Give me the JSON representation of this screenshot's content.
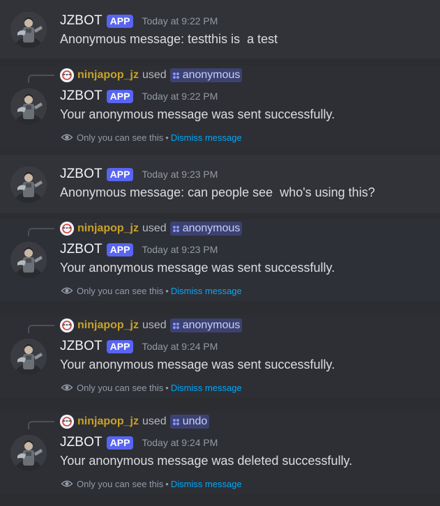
{
  "bot": {
    "name": "JZBOT",
    "badge": "APP"
  },
  "messages": [
    {
      "timestamp": "Today at 9:22 PM",
      "content": "Anonymous message: testthis is  a test"
    },
    {
      "reply": {
        "user": "ninjapop_jz",
        "used": "used",
        "command": "anonymous"
      },
      "timestamp": "Today at 9:22 PM",
      "content": "Your anonymous message was sent successfully."
    },
    {
      "timestamp": "Today at 9:23 PM",
      "content": "Anonymous message: can people see  who's using this?"
    },
    {
      "reply": {
        "user": "ninjapop_jz",
        "used": "used",
        "command": "anonymous"
      },
      "timestamp": "Today at 9:23 PM",
      "content": "Your anonymous message was sent successfully."
    },
    {
      "reply": {
        "user": "ninjapop_jz",
        "used": "used",
        "command": "anonymous"
      },
      "timestamp": "Today at 9:24 PM",
      "content": "Your anonymous message was sent successfully."
    },
    {
      "reply": {
        "user": "ninjapop_jz",
        "used": "used",
        "command": "undo"
      },
      "timestamp": "Today at 9:24 PM",
      "content": "Your anonymous message was deleted successfully."
    }
  ],
  "ephemeral": {
    "only_you": "Only you can see this",
    "separator": "•",
    "dismiss": "Dismiss message"
  },
  "colors": {
    "accent": "#5865f2",
    "link": "#00a8fc",
    "username": "#c9a227",
    "background": "#313338"
  }
}
